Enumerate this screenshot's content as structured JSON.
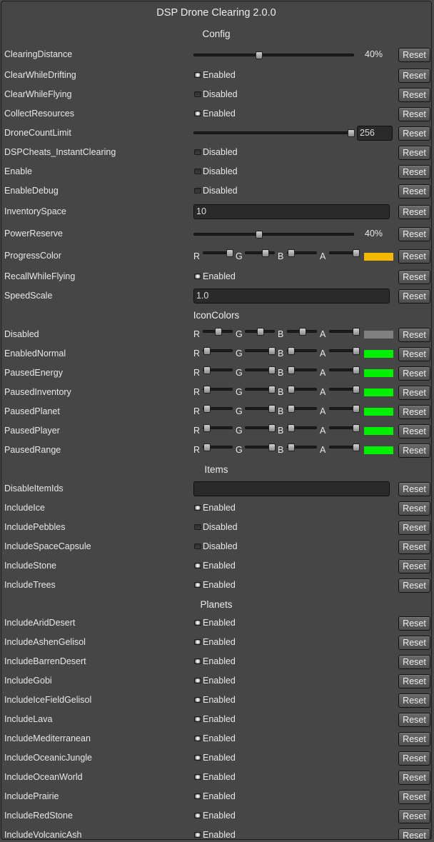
{
  "title": "DSP Drone Clearing 2.0.0",
  "reset_label": "Reset",
  "toggle_enabled": "Enabled",
  "toggle_disabled": "Disabled",
  "channels": [
    "R",
    "G",
    "B",
    "A"
  ],
  "sections": {
    "config": "Config",
    "icon_colors": "IconColors",
    "items": "Items",
    "planets": "Planets"
  },
  "config": {
    "clearing_distance": {
      "label": "ClearingDistance",
      "value_text": "40%",
      "fraction": 0.4
    },
    "clear_while_drifting": {
      "label": "ClearWhileDrifting",
      "enabled": true
    },
    "clear_while_flying": {
      "label": "ClearWhileFlying",
      "enabled": false
    },
    "collect_resources": {
      "label": "CollectResources",
      "enabled": true
    },
    "drone_count_limit": {
      "label": "DroneCountLimit",
      "value_text": "256",
      "fraction": 1.0
    },
    "dsp_cheats": {
      "label": "DSPCheats_InstantClearing",
      "enabled": false
    },
    "enable": {
      "label": "Enable",
      "enabled": false
    },
    "enable_debug": {
      "label": "EnableDebug",
      "enabled": false
    },
    "inventory_space": {
      "label": "InventorySpace",
      "value": "10"
    },
    "power_reserve": {
      "label": "PowerReserve",
      "value_text": "40%",
      "fraction": 0.4
    },
    "progress_color": {
      "label": "ProgressColor",
      "color": "#f5b800",
      "rgba": [
        1.0,
        0.72,
        0.0,
        1.0
      ]
    },
    "recall_while_flying": {
      "label": "RecallWhileFlying",
      "enabled": true
    },
    "speed_scale": {
      "label": "SpeedScale",
      "value": "1.0"
    }
  },
  "icon_colors": [
    {
      "label": "Disabled",
      "color": "#808080",
      "rgba": [
        0.5,
        0.5,
        0.5,
        1.0
      ]
    },
    {
      "label": "EnabledNormal",
      "color": "#00f000",
      "rgba": [
        0.0,
        1.0,
        0.0,
        1.0
      ]
    },
    {
      "label": "PausedEnergy",
      "color": "#00f000",
      "rgba": [
        0.0,
        1.0,
        0.0,
        1.0
      ]
    },
    {
      "label": "PausedInventory",
      "color": "#00f000",
      "rgba": [
        0.0,
        1.0,
        0.0,
        1.0
      ]
    },
    {
      "label": "PausedPlanet",
      "color": "#00f000",
      "rgba": [
        0.0,
        1.0,
        0.0,
        1.0
      ]
    },
    {
      "label": "PausedPlayer",
      "color": "#00f000",
      "rgba": [
        0.0,
        1.0,
        0.0,
        1.0
      ]
    },
    {
      "label": "PausedRange",
      "color": "#00f000",
      "rgba": [
        0.0,
        1.0,
        0.0,
        1.0
      ]
    }
  ],
  "items": {
    "disable_item_ids": {
      "label": "DisableItemIds",
      "value": ""
    },
    "toggles": [
      {
        "label": "IncludeIce",
        "enabled": true
      },
      {
        "label": "IncludePebbles",
        "enabled": false
      },
      {
        "label": "IncludeSpaceCapsule",
        "enabled": false
      },
      {
        "label": "IncludeStone",
        "enabled": true
      },
      {
        "label": "IncludeTrees",
        "enabled": true
      }
    ]
  },
  "planets": [
    {
      "label": "IncludeAridDesert",
      "enabled": true
    },
    {
      "label": "IncludeAshenGelisol",
      "enabled": true
    },
    {
      "label": "IncludeBarrenDesert",
      "enabled": true
    },
    {
      "label": "IncludeGobi",
      "enabled": true
    },
    {
      "label": "IncludeIceFieldGelisol",
      "enabled": true
    },
    {
      "label": "IncludeLava",
      "enabled": true
    },
    {
      "label": "IncludeMediterranean",
      "enabled": true
    },
    {
      "label": "IncludeOceanicJungle",
      "enabled": true
    },
    {
      "label": "IncludeOceanWorld",
      "enabled": true
    },
    {
      "label": "IncludePrairie",
      "enabled": true
    },
    {
      "label": "IncludeRedStone",
      "enabled": true
    },
    {
      "label": "IncludeVolcanicAsh",
      "enabled": true
    }
  ]
}
